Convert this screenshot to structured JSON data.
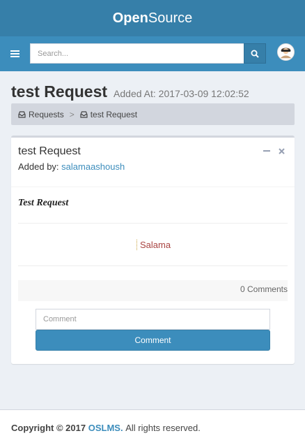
{
  "header": {
    "logo_bold": "Open",
    "logo_light": "Source"
  },
  "search": {
    "placeholder": "Search..."
  },
  "icons": {
    "menu": "bars-icon",
    "search": "search-icon",
    "avatar": "user-avatar",
    "inbox": "inbox-icon",
    "minimize": "minus-icon",
    "close": "times-icon"
  },
  "page": {
    "title": "test Request",
    "subtitle": "Added At: 2017-03-09 12:02:52"
  },
  "breadcrumb": {
    "items": [
      {
        "label": "Requests"
      },
      {
        "label": "test Request"
      }
    ],
    "separator": ">"
  },
  "request": {
    "title": "test Request",
    "added_by_prefix": "Added by:",
    "added_by_user": "salamaashoush",
    "body": "Test Request",
    "signature": "Salama",
    "comments_count": "0 Comments"
  },
  "comment_form": {
    "placeholder": "Comment",
    "button_label": "Comment"
  },
  "footer": {
    "prefix": "Copyright © 2017",
    "brand": "OSLMS.",
    "suffix": "All rights reserved."
  },
  "colors": {
    "header_dark": "#367fa9",
    "header": "#3c8dbc",
    "background": "#ecf0f5",
    "link": "#3c8dbc",
    "signature": "#a94442"
  }
}
